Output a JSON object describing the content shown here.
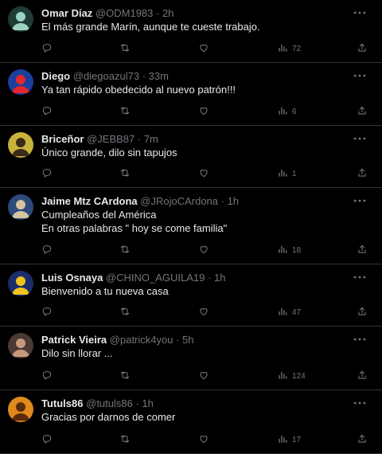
{
  "tweets": [
    {
      "name": "Omar Díaz",
      "handle": "@ODM1983",
      "time": "2h",
      "lines": [
        "El más grande Marín, aunque te cueste trabajo."
      ],
      "views": "72",
      "avatar": {
        "bg": "#1f3b36",
        "fg": "#9bd3c2"
      }
    },
    {
      "name": "Diego",
      "handle": "@diegoazul73",
      "time": "33m",
      "lines": [
        "Ya tan rápido obedecido al nuevo patrón!!!"
      ],
      "views": "6",
      "avatar": {
        "bg": "#1a3f9c",
        "fg": "#e5262b"
      }
    },
    {
      "name": "Briceñor",
      "handle": "@JEBB87",
      "time": "7m",
      "lines": [
        "Único grande, dilo sin tapujos"
      ],
      "views": "1",
      "avatar": {
        "bg": "#c9b23a",
        "fg": "#3a2a1a"
      }
    },
    {
      "name": "Jaime Mtz CArdona",
      "handle": "@JRojoCArdona",
      "time": "1h",
      "lines": [
        "Cumpleaños del América",
        "En otras palabras \" hoy se come familia\""
      ],
      "views": "18",
      "avatar": {
        "bg": "#2c4a7a",
        "fg": "#d6c3a0"
      }
    },
    {
      "name": "Luis Osnaya",
      "handle": "@CHINO_AGUILA19",
      "time": "1h",
      "lines": [
        "Bienvenido a tu nueva casa"
      ],
      "views": "47",
      "avatar": {
        "bg": "#1b2d6b",
        "fg": "#f1c21b"
      }
    },
    {
      "name": "Patrick Vieira",
      "handle": "@patrick4you",
      "time": "5h",
      "lines": [
        "Dilo sin llorar ..."
      ],
      "views": "124",
      "avatar": {
        "bg": "#4a3a33",
        "fg": "#c79a80"
      }
    },
    {
      "name": "Tutuls86",
      "handle": "@tutuls86",
      "time": "1h",
      "lines": [
        "Gracias por darnos de comer"
      ],
      "views": "17",
      "avatar": {
        "bg": "#e08a1e",
        "fg": "#5a2a0a"
      }
    }
  ]
}
